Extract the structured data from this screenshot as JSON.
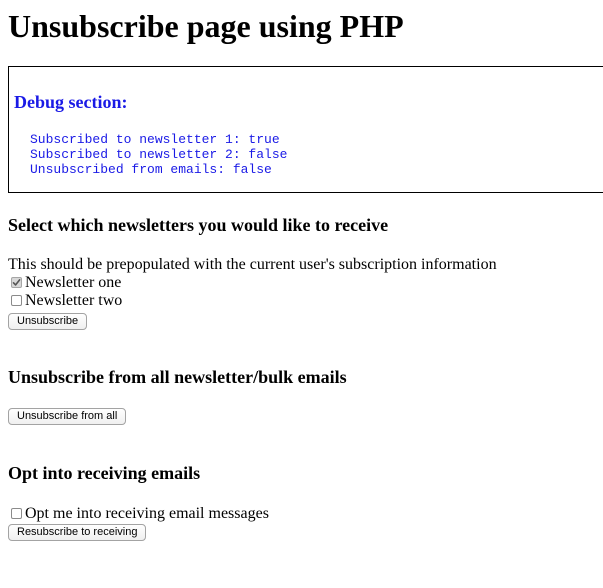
{
  "page": {
    "title": "Unsubscribe page using PHP"
  },
  "debug": {
    "heading": "Debug section:",
    "color": "#1a1ae6",
    "lines": [
      "Subscribed to newsletter 1: true",
      "Subscribed to newsletter 2: false",
      "Unsubscribed from emails: false"
    ]
  },
  "newsletters": {
    "heading": "Select which newsletters you would like to receive",
    "note": "This should be prepopulated with the current user's subscription information",
    "options": [
      {
        "label": "Newsletter one",
        "checked": true
      },
      {
        "label": "Newsletter two",
        "checked": false
      }
    ],
    "button_label": "Unsubscribe"
  },
  "unsubscribe_all": {
    "heading": "Unsubscribe from all newsletter/bulk emails",
    "button_label": "Unsubscribe from all"
  },
  "opt_in": {
    "heading": "Opt into receiving emails",
    "checkbox_label": "Opt me into receiving email messages",
    "checked": false,
    "button_label": "Resubscribe to receiving"
  }
}
